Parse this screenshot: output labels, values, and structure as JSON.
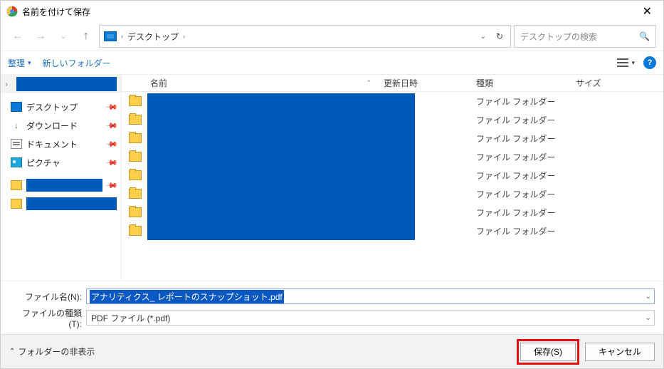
{
  "title": "名前を付けて保存",
  "breadcrumb": {
    "location": "デスクトップ",
    "sep": "›"
  },
  "search": {
    "placeholder": "デスクトップの検索"
  },
  "toolbar": {
    "organize": "整理",
    "newfolder": "新しいフォルダー"
  },
  "columns": {
    "name": "名前",
    "date": "更新日時",
    "type": "種類",
    "size": "サイズ"
  },
  "sidebar": {
    "items": [
      {
        "label": "デスクトップ",
        "icon": "desktop"
      },
      {
        "label": "ダウンロード",
        "icon": "download"
      },
      {
        "label": "ドキュメント",
        "icon": "document"
      },
      {
        "label": "ピクチャ",
        "icon": "picture"
      }
    ]
  },
  "filetype_label": "ファイル フォルダー",
  "file_rows": 8,
  "filename": {
    "label": "ファイル名(N):",
    "value": "アナリティクス_ レポートのスナップショット.pdf"
  },
  "filetype_sel": {
    "label": "ファイルの種類(T):",
    "value": "PDF ファイル (*.pdf)"
  },
  "footer": {
    "hide_folders": "フォルダーの非表示",
    "save": "保存(S)",
    "cancel": "キャンセル"
  }
}
